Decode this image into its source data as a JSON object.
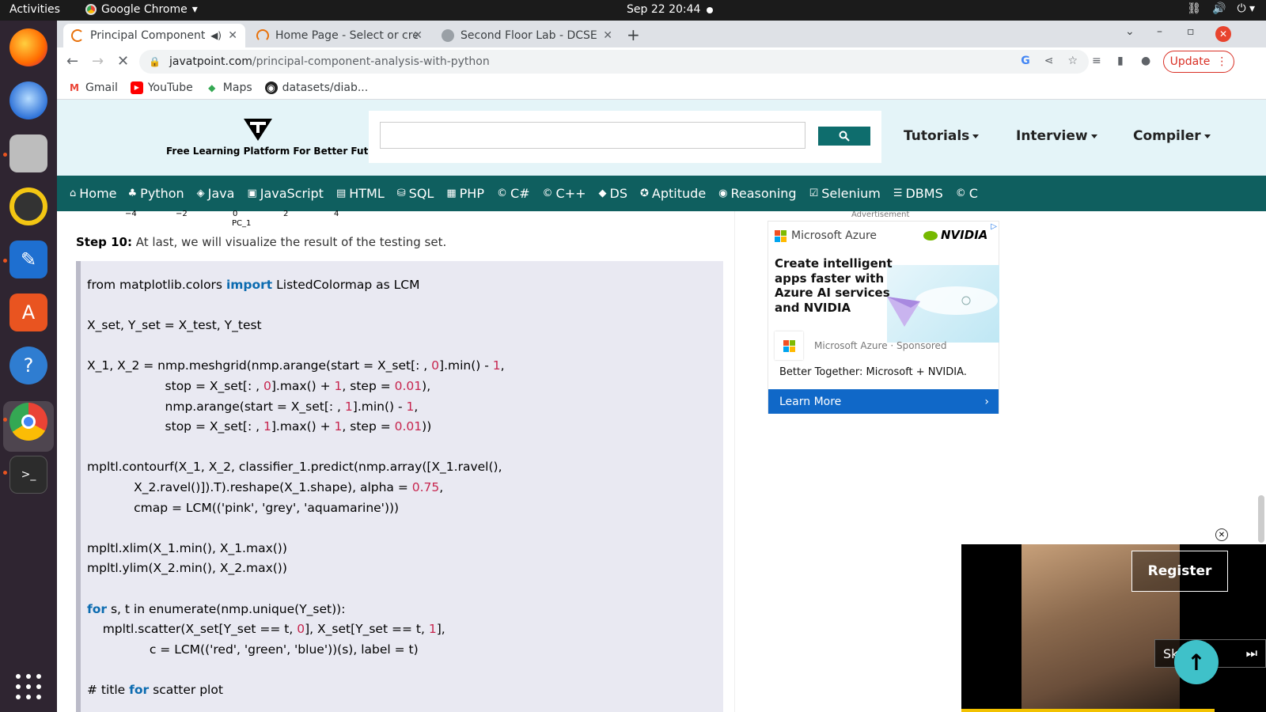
{
  "os": {
    "activities": "Activities",
    "app_name": "Google Chrome",
    "clock": "Sep 22  20:44"
  },
  "dock": {
    "apps": [
      "firefox-icon",
      "thunderbird-icon",
      "files-icon",
      "rhythmbox-icon",
      "writer-icon",
      "software-icon",
      "help-icon",
      "chrome-icon",
      "terminal-icon"
    ]
  },
  "browser": {
    "tabs": [
      {
        "title": "Principal Component A"
      },
      {
        "title": "Home Page - Select or cre"
      },
      {
        "title": "Second Floor Lab - DCSE"
      }
    ],
    "url_host": "javatpoint.com",
    "url_path": "/principal-component-analysis-with-python",
    "update_label": "Update",
    "bookmarks": [
      {
        "label": "Gmail"
      },
      {
        "label": "YouTube"
      },
      {
        "label": "Maps"
      },
      {
        "label": "datasets/diab..."
      }
    ]
  },
  "site": {
    "tagline": "Free Learning Platform For Better Future",
    "search_placeholder": "",
    "nav": {
      "tutorials": "Tutorials",
      "interview": "Interview",
      "compiler": "Compiler"
    },
    "menu": [
      "Home",
      "Python",
      "Java",
      "JavaScript",
      "HTML",
      "SQL",
      "PHP",
      "C#",
      "C++",
      "DS",
      "Aptitude",
      "Reasoning",
      "Selenium",
      "DBMS",
      "C"
    ]
  },
  "article": {
    "axis_ticks": [
      "−4",
      "−2",
      "0",
      "2",
      "4"
    ],
    "axis_label": "PC_1",
    "step_label": "Step 10:",
    "step_text": " At last, we will visualize the result of the testing set."
  },
  "code_lines": [
    [
      {
        "t": "from matplotlib.colors "
      },
      {
        "t": "import",
        "c": "kw"
      },
      {
        "t": " ListedColormap as LCM"
      }
    ],
    [],
    [
      {
        "t": "X_set, Y_set = X_test, Y_test"
      }
    ],
    [],
    [
      {
        "t": "X_1, X_2 = nmp.meshgrid(nmp.arange(start = X_set[: , "
      },
      {
        "t": "0",
        "c": "num"
      },
      {
        "t": "].min() - "
      },
      {
        "t": "1",
        "c": "num"
      },
      {
        "t": ","
      }
    ],
    [
      {
        "t": "                    stop = X_set[: , "
      },
      {
        "t": "0",
        "c": "num"
      },
      {
        "t": "].max() + "
      },
      {
        "t": "1",
        "c": "num"
      },
      {
        "t": ", step = "
      },
      {
        "t": "0.01",
        "c": "num"
      },
      {
        "t": "),"
      }
    ],
    [
      {
        "t": "                    nmp.arange(start = X_set[: , "
      },
      {
        "t": "1",
        "c": "num"
      },
      {
        "t": "].min() - "
      },
      {
        "t": "1",
        "c": "num"
      },
      {
        "t": ","
      }
    ],
    [
      {
        "t": "                    stop = X_set[: , "
      },
      {
        "t": "1",
        "c": "num"
      },
      {
        "t": "].max() + "
      },
      {
        "t": "1",
        "c": "num"
      },
      {
        "t": ", step = "
      },
      {
        "t": "0.01",
        "c": "num"
      },
      {
        "t": "))"
      }
    ],
    [],
    [
      {
        "t": "mpltl.contourf(X_1, X_2, classifier_1.predict(nmp.array([X_1.ravel(),"
      }
    ],
    [
      {
        "t": "            X_2.ravel()]).T).reshape(X_1.shape), alpha = "
      },
      {
        "t": "0.75",
        "c": "num"
      },
      {
        "t": ","
      }
    ],
    [
      {
        "t": "            cmap = LCM(('pink', 'grey', 'aquamarine')))"
      }
    ],
    [],
    [
      {
        "t": "mpltl.xlim(X_1.min(), X_1.max())"
      }
    ],
    [
      {
        "t": "mpltl.ylim(X_2.min(), X_2.max())"
      }
    ],
    [],
    [
      {
        "t": "for",
        "c": "kw"
      },
      {
        "t": " s, t in enumerate(nmp.unique(Y_set)):"
      }
    ],
    [
      {
        "t": "    mpltl.scatter(X_set[Y_set == t, "
      },
      {
        "t": "0",
        "c": "num"
      },
      {
        "t": "], X_set[Y_set == t, "
      },
      {
        "t": "1",
        "c": "num"
      },
      {
        "t": "],"
      }
    ],
    [
      {
        "t": "                c = LCM(('red', 'green', 'blue'))(s), label = t)"
      }
    ],
    [],
    [
      {
        "t": "# title "
      },
      {
        "t": "for",
        "c": "kw"
      },
      {
        "t": " scatter plot"
      }
    ]
  ],
  "ad": {
    "label": "Advertisement",
    "brand": "Microsoft Azure",
    "partner": "NVIDIA",
    "headline": "Create intelligent apps faster with Azure AI services and NVIDIA",
    "source": "Microsoft Azure",
    "sponsored": "Sponsored",
    "tagline": "Better Together: Microsoft + NVIDIA.",
    "cta": "Learn More"
  },
  "video": {
    "register": "Register",
    "skip": "Skip"
  },
  "colors": {
    "menubar": "#0f5f5f",
    "header_bg": "#e4f4f8",
    "keyword": "#0b6bb0",
    "number": "#c7254e"
  }
}
